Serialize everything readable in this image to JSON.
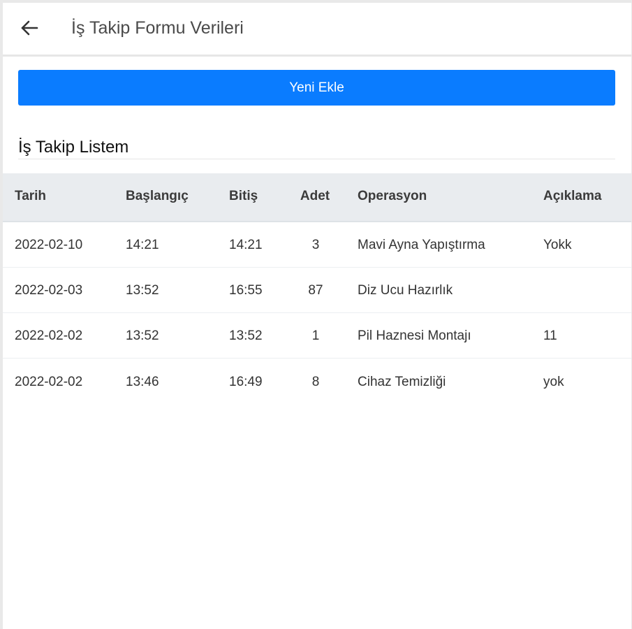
{
  "header": {
    "title": "İş Takip Formu Verileri",
    "back_icon": "arrow-left-icon"
  },
  "actions": {
    "add_label": "Yeni Ekle",
    "add_color": "#0a7cff"
  },
  "section": {
    "title": "İş Takip Listem"
  },
  "table": {
    "headers": [
      "Tarih",
      "Başlangıç",
      "Bitiş",
      "Adet",
      "Operasyon",
      "Açıklama"
    ],
    "rows": [
      [
        "2022-02-10",
        "14:21",
        "14:21",
        "3",
        "Mavi Ayna Yapıştırma",
        "Yokk"
      ],
      [
        "2022-02-03",
        "13:52",
        "16:55",
        "87",
        "Diz Ucu Hazırlık",
        ""
      ],
      [
        "2022-02-02",
        "13:52",
        "13:52",
        "1",
        "Pil Haznesi Montajı",
        "11"
      ],
      [
        "2022-02-02",
        "13:46",
        "16:49",
        "8",
        "Cihaz Temizliği",
        "yok"
      ]
    ]
  }
}
